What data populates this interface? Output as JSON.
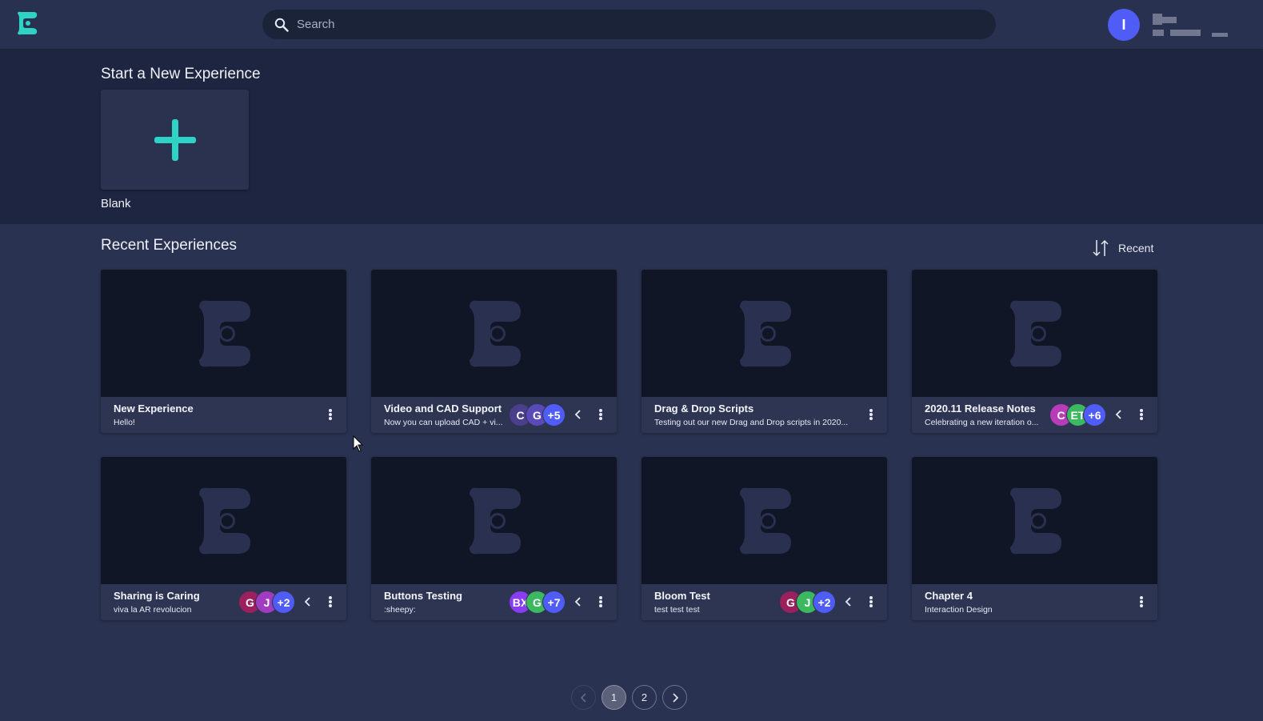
{
  "header": {
    "logo_icon": "experience-logo-icon",
    "search_placeholder": "Search",
    "user_initial": "I",
    "accent_color": "#2ed3c6"
  },
  "new_section": {
    "title": "Start a New Experience",
    "blank_label": "Blank"
  },
  "recent": {
    "title": "Recent Experiences",
    "sort_label": "Recent",
    "cards": [
      {
        "title": "New Experience",
        "desc": "Hello!",
        "collaborators": []
      },
      {
        "title": "Video and CAD Support",
        "desc": "Now you can upload CAD + vi...",
        "collaborators": [
          {
            "label": "C",
            "color": "#4a3f8c"
          },
          {
            "label": "G",
            "color": "#5a4ab8"
          },
          {
            "label": "+5",
            "color": "#4f5cf5"
          }
        ]
      },
      {
        "title": "Drag & Drop Scripts",
        "desc": "Testing out our new Drag and Drop scripts in 2020...",
        "collaborators": []
      },
      {
        "title": "2020.11 Release Notes",
        "desc": "Celebrating a new iteration o...",
        "collaborators": [
          {
            "label": "C",
            "color": "#b83cb8"
          },
          {
            "label": "ET",
            "color": "#3cb860"
          },
          {
            "label": "+6",
            "color": "#4f5cf5"
          }
        ]
      },
      {
        "title": "Sharing is Caring",
        "desc": "viva la AR revolucion",
        "collaborators": [
          {
            "label": "G",
            "color": "#9c1f5e"
          },
          {
            "label": "J",
            "color": "#a03cc0"
          },
          {
            "label": "+2",
            "color": "#4f5cf5"
          }
        ]
      },
      {
        "title": "Buttons Testing",
        "desc": ":sheepy:",
        "collaborators": [
          {
            "label": "BX",
            "color": "#8a3cf0"
          },
          {
            "label": "G",
            "color": "#3cb860"
          },
          {
            "label": "+7",
            "color": "#4f5cf5"
          }
        ]
      },
      {
        "title": "Bloom Test",
        "desc": "test test test",
        "collaborators": [
          {
            "label": "G",
            "color": "#9c1f5e"
          },
          {
            "label": "J",
            "color": "#3cb860"
          },
          {
            "label": "+2",
            "color": "#4f5cf5"
          }
        ]
      },
      {
        "title": "Chapter 4",
        "desc": "Interaction Design",
        "collaborators": []
      }
    ]
  },
  "pagination": {
    "pages": [
      "1",
      "2"
    ],
    "current": "1"
  }
}
